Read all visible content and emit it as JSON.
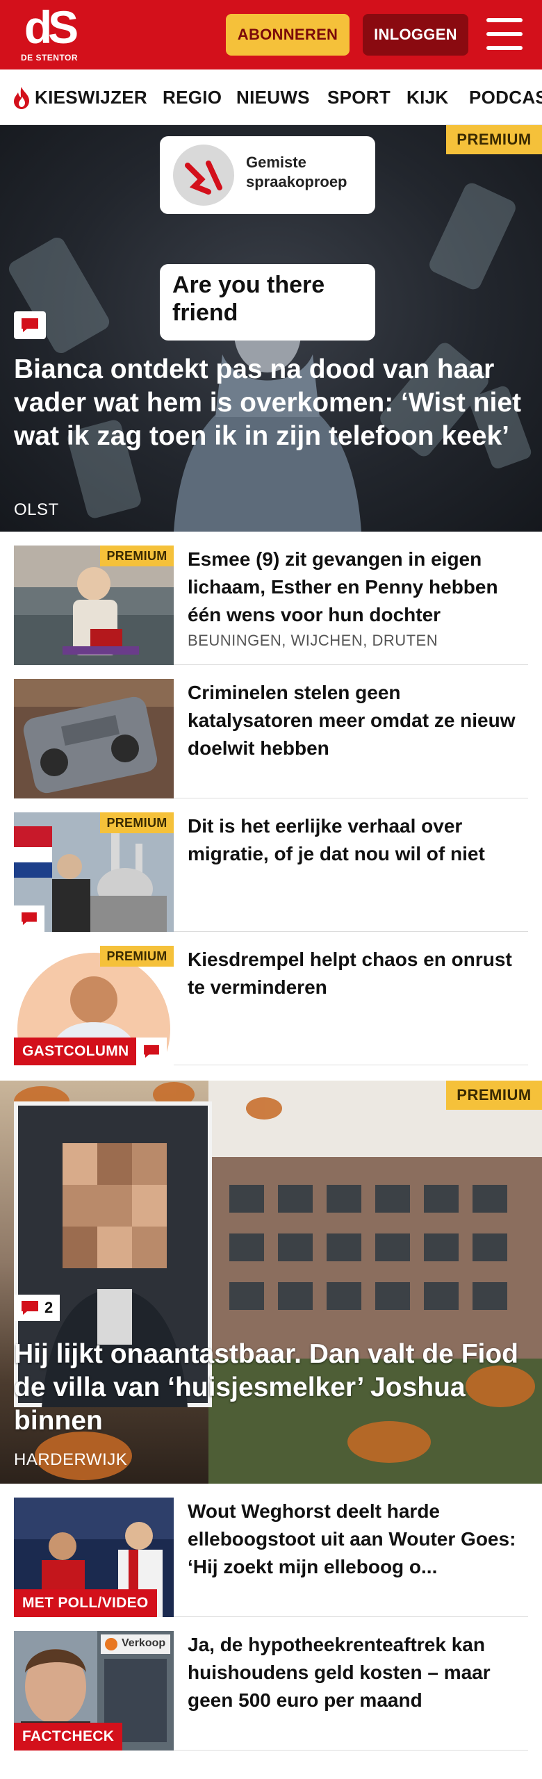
{
  "header": {
    "logo_mark": "dS",
    "logo_sub": "DE STENTOR",
    "subscribe_label": "ABONNEREN",
    "login_label": "INLOGGEN",
    "menu_icon": "hamburger-menu-icon"
  },
  "nav": {
    "items": [
      {
        "label": "KIESWIJZER",
        "icon": "flame-icon"
      },
      {
        "label": "REGIO"
      },
      {
        "label": "NIEUWS"
      },
      {
        "label": "SPORT"
      },
      {
        "label": "KIJK"
      },
      {
        "label": "PODCAS"
      }
    ]
  },
  "colors": {
    "brand_red": "#d3101b",
    "premium_yellow": "#f5c13a",
    "login_dark_red": "#8a0a10"
  },
  "hero1": {
    "badge": "PREMIUM",
    "overlay_notification_title": "Gemiste spraakoproep",
    "overlay_chat_text": "Are you there friend",
    "title": "Bianca ontdekt pas na dood van haar vader wat hem is overkomen: ‘Wist niet wat ik zag toen ik in zijn telefoon keek’",
    "location": "OLST",
    "comment_icon": "comment-icon"
  },
  "articles": [
    {
      "badge": "PREMIUM",
      "title": "Esmee (9) zit gevangen in eigen lichaam, Esther en Penny hebben één wens voor hun dochter",
      "location": "BEUNINGEN, WIJCHEN, DRUTEN"
    },
    {
      "title": "Criminelen stelen geen katalysatoren meer omdat ze nieuw doelwit hebben"
    },
    {
      "badge": "PREMIUM",
      "title": "Dit is het eerlijke verhaal over migratie, of je dat nou wil of niet",
      "comment_icon": "comment-icon"
    },
    {
      "badge": "PREMIUM",
      "tag": "GASTCOLUMN",
      "title": "Kiesdrempel helpt chaos en onrust te verminderen",
      "comment_icon": "comment-icon"
    }
  ],
  "hero2": {
    "badge": "PREMIUM",
    "comment_count": "2",
    "title": "Hij lijkt onaantastbaar. Dan valt de Fiod de villa van ‘huisjesmelker’ Joshua binnen",
    "location": "HARDERWIJK"
  },
  "articles2": [
    {
      "tag": "MET POLL/VIDEO",
      "title": "Wout Weghorst deelt harde elleboogstoot uit aan Wouter Goes: ‘Hij zoekt mijn elleboog o..."
    },
    {
      "tag": "FACTCHECK",
      "sign_text": "Verkoop",
      "title": "Ja, de hypotheekrenteaftrek kan huishoudens geld kosten – maar geen 500 euro per maand"
    }
  ]
}
